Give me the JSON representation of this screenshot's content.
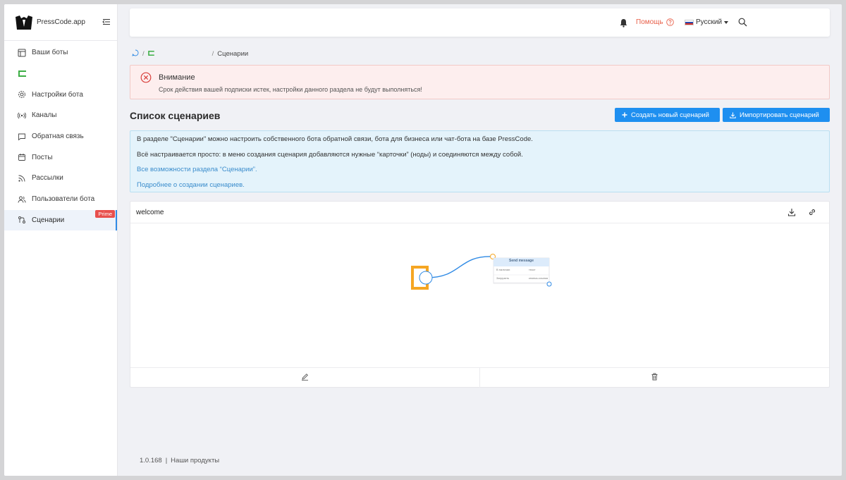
{
  "brand": {
    "name": "PressCode.app"
  },
  "sidebar": {
    "items": [
      {
        "label": "Ваши боты",
        "icon": "layout-icon"
      },
      {
        "label": "",
        "icon": "bot-mark-icon"
      },
      {
        "label": "Настройки бота",
        "icon": "gear-icon"
      },
      {
        "label": "Каналы",
        "icon": "broadcast-icon"
      },
      {
        "label": "Обратная связь",
        "icon": "chat-icon"
      },
      {
        "label": "Посты",
        "icon": "calendar-icon"
      },
      {
        "label": "Рассылки",
        "icon": "rss-icon"
      },
      {
        "label": "Пользователи бота",
        "icon": "users-icon"
      },
      {
        "label": "Сценарии",
        "icon": "flow-icon",
        "active": true,
        "badge": "Prime"
      }
    ]
  },
  "topbar": {
    "help_label": "Помощь",
    "language": "Русский"
  },
  "breadcrumb": {
    "sep1": "/",
    "sep2": "/",
    "current": "Сценарии"
  },
  "alert": {
    "title": "Внимание",
    "text": "Срок действия вашей подписки истек, настройки данного раздела не будут выполняться!"
  },
  "section": {
    "title": "Список сценариев",
    "create_label": "Создать новый сценарий",
    "import_label": "Импортировать сценарий"
  },
  "info": {
    "line1": "В разделе \"Сценарии\" можно настроить собственного бота обратной связи, бота для бизнеса или чат-бота на базе PressCode.",
    "line2": "Всё настраивается просто: в меню создания сценария добавляются нужные “карточки” (ноды) и соединяются между собой.",
    "link1": "Все возможности раздела “Сценарии”.",
    "link2": "Подробнее о создании сценариев."
  },
  "scenario": {
    "name": "welcome",
    "node_title": "Send message",
    "node_row1_left": "В наличии",
    "node_row1_right": "текст",
    "node_row2_left": "Загрузить",
    "node_row2_right": "кнопка-ссылка"
  },
  "footer": {
    "version": "1.0.168",
    "divider": "|",
    "products_label": "Наши продукты"
  },
  "colors": {
    "accent": "#1e8ff0",
    "help": "#e8604a",
    "danger": "#e8504d",
    "start_node": "#f5a623"
  }
}
